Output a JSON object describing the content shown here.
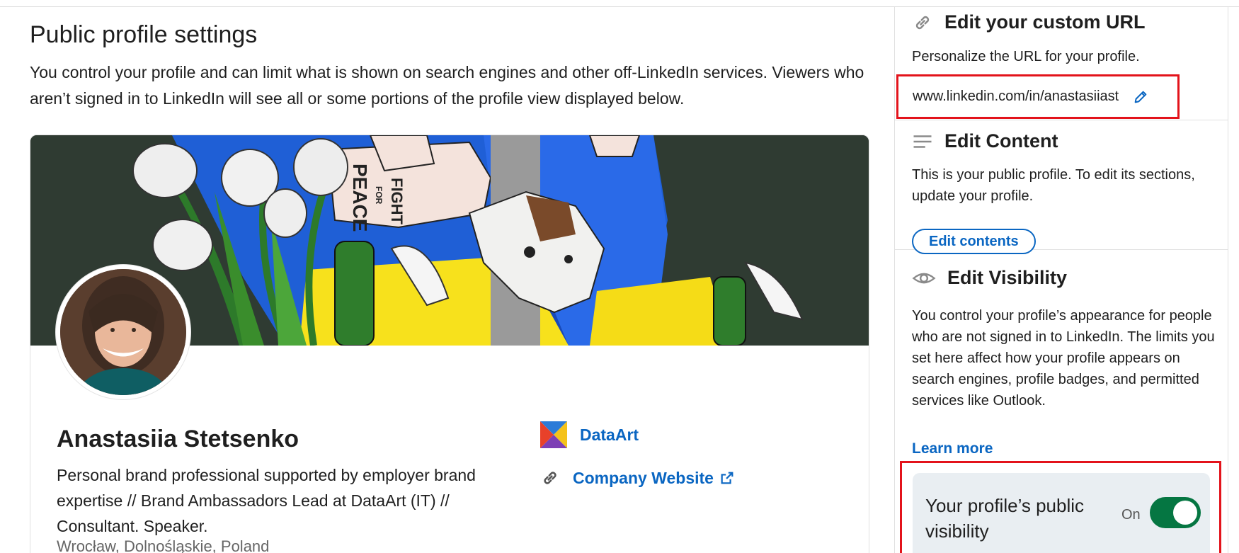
{
  "main": {
    "title": "Public profile settings",
    "description": "You control your profile and can limit what is shown on search engines and other off-LinkedIn services. Viewers who aren’t signed in to LinkedIn will see all or some portions of the profile view displayed below.",
    "profile": {
      "name": "Anastasiia Stetsenko",
      "headline": "Personal brand professional supported by employer brand expertise // Brand Ambassadors Lead at DataArt (IT) // Consultant. Speaker.",
      "location": "Wrocław, Dolnośląskie, Poland",
      "company": "DataArt",
      "website": "Company Website",
      "banner_text_1": "FIGHT",
      "banner_text_2": "FOR",
      "banner_text_3": "PEACE"
    }
  },
  "sidebar": {
    "custom_url": {
      "title": "Edit your custom URL",
      "description": "Personalize the URL for your profile.",
      "url": "www.linkedin.com/in/anastasiiast"
    },
    "content": {
      "title": "Edit Content",
      "description": "This is your public profile. To edit its sections, update your profile.",
      "button": "Edit contents"
    },
    "visibility": {
      "title": "Edit Visibility",
      "description": "You control your profile’s appearance for people who are not signed in to LinkedIn. The limits you set here affect how your profile appears on search engines, profile badges, and permitted services like Outlook.",
      "learn_more": "Learn more",
      "toggle_label": "Your profile’s public visibility",
      "toggle_state": "On"
    }
  },
  "icons": {
    "url": "link-icon",
    "content": "lines-icon",
    "visibility": "eye-icon",
    "edit": "pencil-icon",
    "website": "link-icon",
    "external": "external-link-icon"
  },
  "colors": {
    "link": "#0a66c2",
    "toggle_on": "#057642",
    "highlight": "#e3131b"
  }
}
